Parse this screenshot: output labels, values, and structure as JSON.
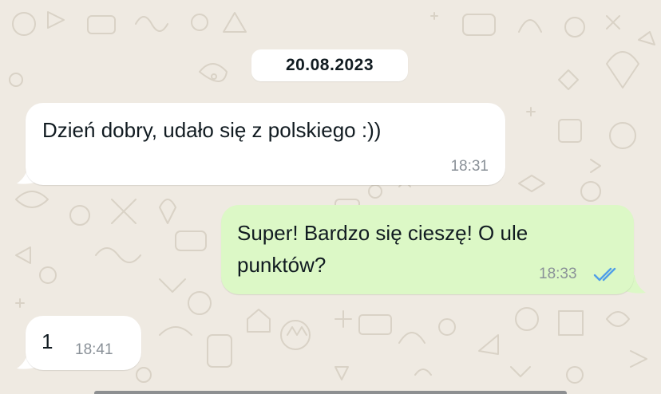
{
  "chat": {
    "background_color": "#efeae2",
    "date_separator": "20.08.2023",
    "messages": [
      {
        "direction": "incoming",
        "text": "Dzień dobry, udało się z polskiego :))",
        "time": "18:31"
      },
      {
        "direction": "outgoing",
        "text_line1": "Super! Bardzo się cieszę! O ule",
        "text_line2": "punktów?",
        "time": "18:33",
        "status_icon": "double-check-icon",
        "status_color": "#4f9ee8"
      },
      {
        "direction": "incoming",
        "text": "1",
        "time": "18:41"
      }
    ],
    "bubble_colors": {
      "incoming": "#ffffff",
      "outgoing": "#dcf8c6"
    }
  }
}
